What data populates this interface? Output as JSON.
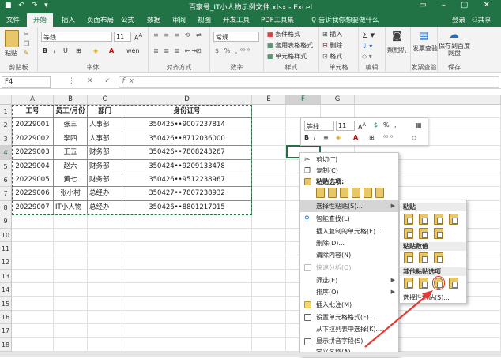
{
  "window": {
    "title": "百家号_IT小人物示例文件.xlsx - Excel"
  },
  "ribbon_tabs": [
    "文件",
    "开始",
    "插入",
    "页面布局",
    "公式",
    "数据",
    "审阅",
    "视图",
    "开发工具",
    "PDF工具集"
  ],
  "active_tab": "开始",
  "tell_me": "告诉我你想要做什么",
  "login": "登录",
  "share": "共享",
  "ribbon": {
    "paste_label": "粘贴",
    "clipboard_label": "剪贴板",
    "font_name": "等线",
    "font_size": "11",
    "font_label": "字体",
    "align_label": "对齐方式",
    "number_format": "常规",
    "number_label": "数字",
    "cond_format": "条件格式",
    "table_format": "套用表格格式",
    "cell_style": "单元格样式",
    "style_label": "样式",
    "insert": "插入",
    "delete": "删除",
    "format": "格式",
    "cells_label": "单元格",
    "edit_label": "编辑",
    "photo": "照相机",
    "invoice_check": "发票查验",
    "invoice_label": "发票查验",
    "save_baidu": "保存到百度网盘",
    "save_label": "保存"
  },
  "name_box": "F4",
  "columns": [
    "A",
    "B",
    "C",
    "D",
    "E",
    "F",
    "G"
  ],
  "rows": [
    "1",
    "2",
    "3",
    "4",
    "5",
    "6",
    "7",
    "8",
    "9",
    "10",
    "11",
    "12",
    "13",
    "14",
    "15",
    "16",
    "17",
    "18"
  ],
  "table": {
    "headers": [
      "工号",
      "员工/月份",
      "部门",
      "身份证号"
    ],
    "rows": [
      [
        "20229001",
        "张三",
        "人事部",
        "350425••9007237814"
      ],
      [
        "20229002",
        "李四",
        "人事部",
        "350426••8712036000"
      ],
      [
        "20229003",
        "王五",
        "财务部",
        "350426••7808243267"
      ],
      [
        "20229004",
        "赵六",
        "财务部",
        "350424••9209133478"
      ],
      [
        "20229005",
        "黄七",
        "财务部",
        "350426••9512238967"
      ],
      [
        "20229006",
        "张小村",
        "总经办",
        "350427••7807238932"
      ],
      [
        "20229007",
        "IT小人物",
        "总经办",
        "350426••8801217015"
      ]
    ]
  },
  "mini_toolbar": {
    "font": "等线",
    "size": "11",
    "percent": "%",
    "comma": ","
  },
  "context_menu": {
    "items": [
      {
        "label": "剪切(T)",
        "icon": "scissors-icon"
      },
      {
        "label": "复制(C)",
        "icon": "copy-icon"
      },
      {
        "label": "粘贴选项:",
        "icon": "paste-icon"
      },
      {
        "label": "选择性粘贴(S)...",
        "icon": ""
      },
      {
        "label": "智能查找(L)",
        "icon": "search-icon"
      },
      {
        "label": "插入复制的单元格(E)...",
        "icon": ""
      },
      {
        "label": "删除(D)...",
        "icon": ""
      },
      {
        "label": "清除内容(N)",
        "icon": ""
      },
      {
        "label": "快速分析(Q)",
        "icon": "quick-analysis-icon"
      },
      {
        "label": "筛选(E)",
        "icon": ""
      },
      {
        "label": "排序(O)",
        "icon": ""
      },
      {
        "label": "插入批注(M)",
        "icon": "comment-icon"
      },
      {
        "label": "设置单元格格式(F)...",
        "icon": "format-cells-icon"
      },
      {
        "label": "从下拉列表中选择(K)...",
        "icon": ""
      },
      {
        "label": "显示拼音字段(S)",
        "icon": "phonetic-icon"
      },
      {
        "label": "定义名称(A)...",
        "icon": ""
      }
    ]
  },
  "paste_submenu": {
    "sections": [
      "粘贴",
      "粘贴数值",
      "其他粘贴选项"
    ],
    "footer": "选择性粘贴(S)..."
  }
}
